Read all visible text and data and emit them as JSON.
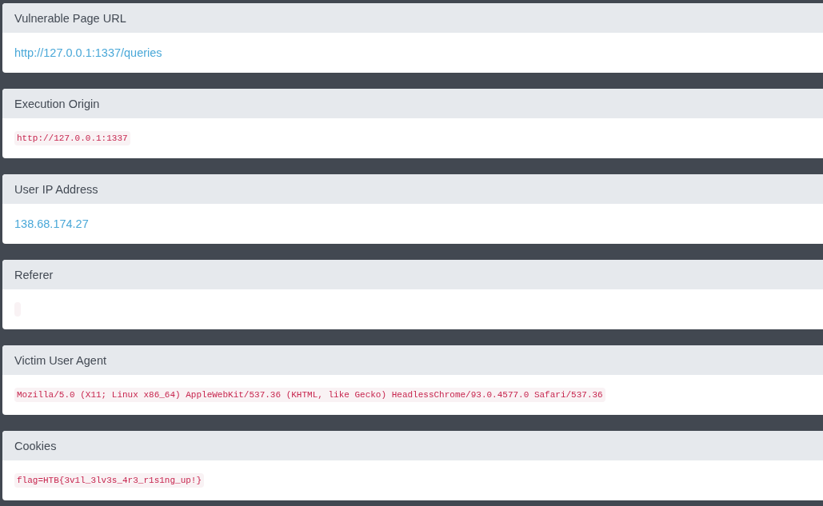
{
  "panels": [
    {
      "title": "Vulnerable Page URL",
      "kind": "link",
      "value": "http://127.0.0.1:1337/queries"
    },
    {
      "title": "Execution Origin",
      "kind": "code",
      "value": "http://127.0.0.1:1337"
    },
    {
      "title": "User IP Address",
      "kind": "link",
      "value": "138.68.174.27"
    },
    {
      "title": "Referer",
      "kind": "code"
    },
    {
      "title": "Victim User Agent",
      "kind": "code",
      "value": "Mozilla/5.0 (X11; Linux x86_64) AppleWebKit/537.36 (KHTML, like Gecko) HeadlessChrome/93.0.4577.0 Safari/537.36"
    },
    {
      "title": "Cookies",
      "kind": "code",
      "value": "flag=HTB{3v1l_3lv3s_4r3_r1s1ng_up!}"
    }
  ]
}
